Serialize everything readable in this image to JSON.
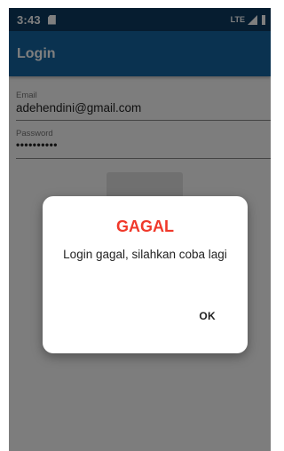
{
  "status_bar": {
    "time": "3:43",
    "sd_icon": "sd-card-icon",
    "network": "LTE",
    "signal_icon": "signal-icon",
    "battery_icon": "battery-icon"
  },
  "app_bar": {
    "title": "Login",
    "color": "#1565a0"
  },
  "form": {
    "email": {
      "label": "Email",
      "value": "adehendini@gmail.com"
    },
    "password": {
      "label": "Password",
      "value": "••••••••••"
    }
  },
  "dialog": {
    "title": "GAGAL",
    "title_color": "#f0392b",
    "message": "Login gagal, silahkan coba lagi",
    "ok_label": "OK"
  }
}
